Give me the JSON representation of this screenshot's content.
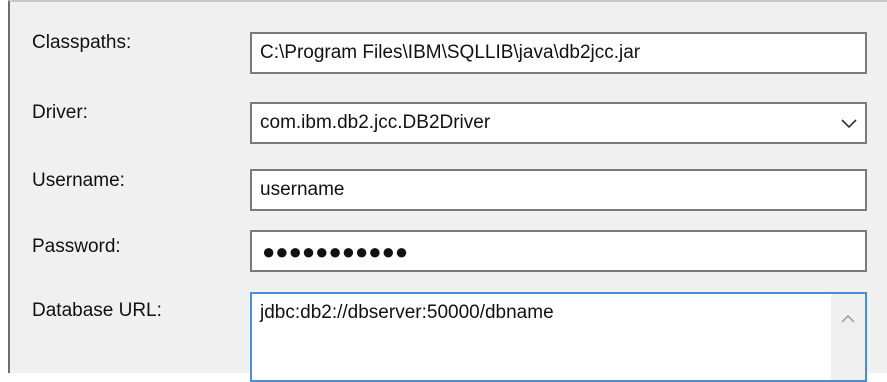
{
  "form": {
    "classpaths": {
      "label": "Classpaths:",
      "value": "C:\\Program Files\\IBM\\SQLLIB\\java\\db2jcc.jar"
    },
    "driver": {
      "label": "Driver:",
      "value": "com.ibm.db2.jcc.DB2Driver"
    },
    "username": {
      "label": "Username:",
      "value": "username"
    },
    "password": {
      "label": "Password:",
      "value": "●●●●●●●●●●●"
    },
    "database_url": {
      "label": "Database URL:",
      "value": "jdbc:db2://dbserver:50000/dbname"
    }
  },
  "icons": {
    "dropdown": "chevron-down-icon",
    "scroll_up": "chevron-up-icon"
  }
}
